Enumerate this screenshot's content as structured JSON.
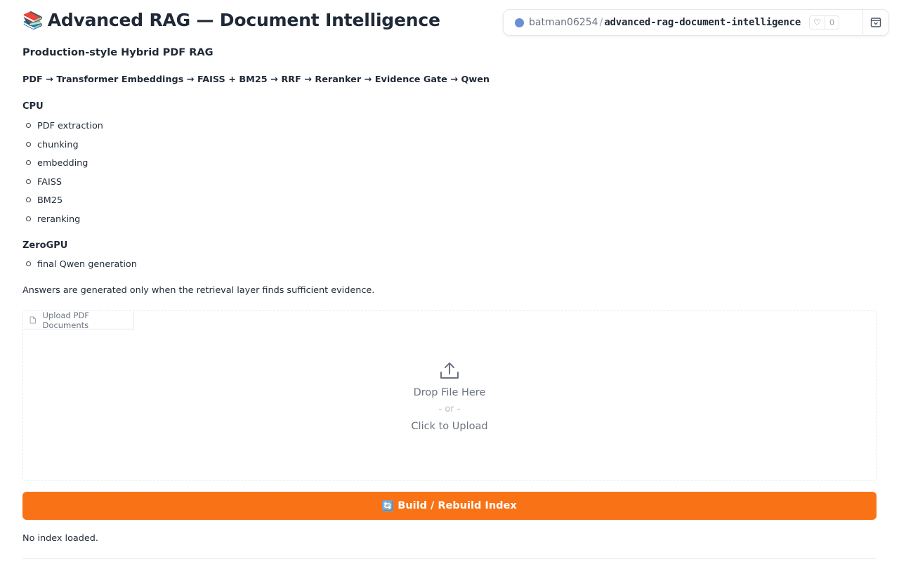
{
  "header": {
    "title_icon": "📚",
    "title": "Advanced RAG — Document Intelligence",
    "subtitle": "Production-style Hybrid PDF RAG",
    "pipeline": "PDF → Transformer Embeddings → FAISS + BM25 → RRF → Reranker → Evidence Gate → Qwen"
  },
  "space_badge": {
    "owner": "batman06254",
    "separator": "/",
    "repo": "advanced-rag-document-intelligence",
    "like_count": "0",
    "owner_color": "#6b8fd6"
  },
  "cpu": {
    "heading": "CPU",
    "items": [
      "PDF extraction",
      "chunking",
      "embedding",
      "FAISS",
      "BM25",
      "reranking"
    ]
  },
  "zerogpu": {
    "heading": "ZeroGPU",
    "items": [
      "final Qwen generation"
    ]
  },
  "note": "Answers are generated only when the retrieval layer finds sufficient evidence.",
  "upload": {
    "label": "Upload PDF Documents",
    "drop_text": "Drop File Here",
    "or_text": "- or -",
    "click_text": "Click to Upload"
  },
  "build_button": {
    "icon": "🔄",
    "label": "Build / Rebuild Index",
    "color": "#f97316"
  },
  "status": "No index loaded."
}
